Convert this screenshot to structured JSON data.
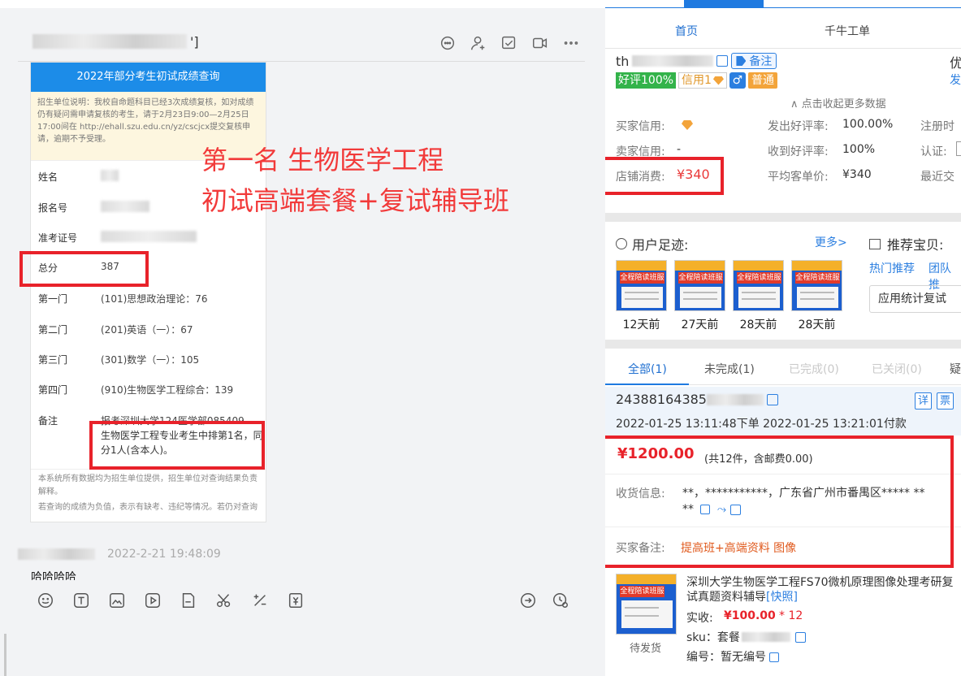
{
  "chat": {
    "title_suffix": "']",
    "card": {
      "header": "2022年部分考生初试成绩查询",
      "notice": "招生单位说明：我校自命题科目已经3次成绩复核，如对成绩仍有疑问需申请复核的考生，请于2月23日9:00—2月25日17:00间在 http://ehall.szu.edu.cn/yz/cscjcx提交复核申请，逾期不予受理。",
      "rows": [
        {
          "label": "姓名",
          "value": ""
        },
        {
          "label": "报名号",
          "value": ""
        },
        {
          "label": "准考证号",
          "value": ""
        },
        {
          "label": "总分",
          "value": "387"
        },
        {
          "label": "第一门",
          "value": "(101)思想政治理论：76"
        },
        {
          "label": "第二门",
          "value": "(201)英语（一）：67"
        },
        {
          "label": "第三门",
          "value": "(301)数学（一）：105"
        },
        {
          "label": "第四门",
          "value": "(910)生物医学工程综合：139"
        },
        {
          "label": "备注",
          "value": "报考深圳大学124医学部085409"
        }
      ],
      "note_highlight": "生物医学工程专业考生中排第1名，同分1人(含本人)。",
      "footer_1": "本系统所有数据均为招生单位提供，招生单位对查询结果负责解释。",
      "footer_2": "若查询的成绩为负值，表示有缺考、违纪等情况。若仍对查询结果有疑问，请咨询相应的招生单位。"
    },
    "annotation_line1": "第一名 生物医学工程",
    "annotation_line2": "初试高端套餐+复试辅导班",
    "message_time": "2022-2-21 19:48:09",
    "message_text": "哈哈哈哈"
  },
  "side": {
    "tabs": {
      "home": "首页",
      "qianniu": "千牛工单"
    },
    "buyer_id_partial": "th",
    "tag_label": "备注",
    "head_right_1": "优",
    "head_right_2": "发",
    "badges": {
      "good": "好评100%",
      "credit": "信用1",
      "gender": "♂",
      "level": "普通"
    },
    "collapse_link": "∧ 点击收起更多数据",
    "info": {
      "buyer_credit_label": "买家信用:",
      "seller_credit_label": "卖家信用:",
      "seller_credit_value": "-",
      "shop_spend_label": "店铺消费:",
      "shop_spend_value": "¥340",
      "sent_good_label": "发出好评率:",
      "sent_good_value": "100.00%",
      "recv_good_label": "收到好评率:",
      "recv_good_value": "100%",
      "avg_price_label": "平均客单价:",
      "avg_price_value": "¥340",
      "register_label": "注册时",
      "auth_label": "认证:",
      "recent_label": "最近交"
    },
    "footprint": {
      "title": "用户足迹:",
      "more": "更多>",
      "thumb_band": "全程陪读班服务",
      "items": [
        "12天前",
        "27天前",
        "28天前",
        "28天前"
      ]
    },
    "recommend": {
      "title": "推荐宝贝:",
      "hot": "热门推荐",
      "team": "团队推",
      "select_value": "应用统计复试"
    },
    "order_tabs": {
      "all": "全部(1)",
      "incomplete": "未完成(1)",
      "done": "已完成(0)",
      "closed": "已关闭(0)",
      "doubt": "疑"
    },
    "order": {
      "number_prefix": "24388164385",
      "btn_detail": "详",
      "btn_ticket": "票",
      "times": "2022-01-25 13:11:48下单  2022-01-25 13:21:01付款",
      "price": "¥1200.00",
      "price_sub": "(共12件，含邮费0.00)",
      "recv_label": "收货信息:",
      "recv_value": "**，***********，广东省广州市番禺区*****  **",
      "recv_value_2": "**",
      "remark_label": "买家备注:",
      "remark_value": "提高班+高端资料 图像"
    },
    "product": {
      "title": "深圳大学生物医学工程FS70微机原理图像处理考研复试真题资料辅导",
      "snapshot": "[快照]",
      "paid_label": "实收:",
      "paid_value": "¥100.00",
      "qty": "* 12",
      "sku_label": "sku：套餐",
      "code_label": "编号：暂无编号",
      "status": "待发货"
    }
  }
}
